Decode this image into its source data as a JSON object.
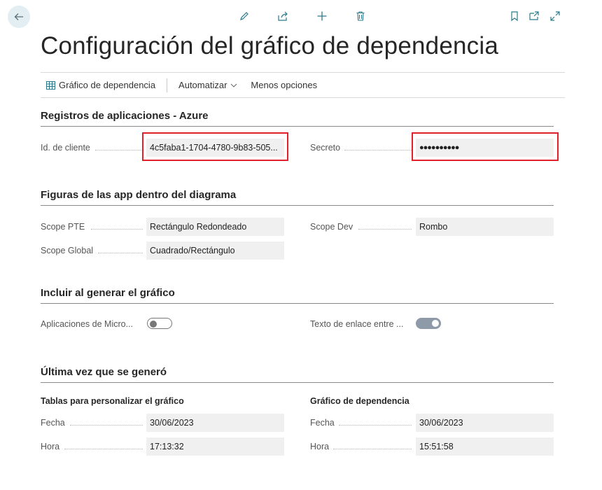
{
  "toolbar": {
    "icons": [
      "back-arrow-icon",
      "pencil-icon",
      "share-icon",
      "plus-icon",
      "trash-icon",
      "bookmark-icon",
      "popout-icon",
      "expand-icon"
    ]
  },
  "page": {
    "title": "Configuración del gráfico de dependencia"
  },
  "actions": {
    "chart": "Gráfico de dependencia",
    "automate": "Automatizar",
    "less_options": "Menos opciones"
  },
  "sections": {
    "azure": {
      "title": "Registros de aplicaciones - Azure",
      "client_id_label": "Id. de cliente",
      "client_id_value": "4c5faba1-1704-4780-9b83-505...",
      "secret_label": "Secreto",
      "secret_value": "●●●●●●●●●●"
    },
    "shapes": {
      "title": "Figuras de las app dentro del diagrama",
      "pte_label": "Scope PTE",
      "pte_value": "Rectángulo Redondeado",
      "dev_label": "Scope Dev",
      "dev_value": "Rombo",
      "global_label": "Scope Global",
      "global_value": "Cuadrado/Rectángulo"
    },
    "include": {
      "title": "Incluir al generar el gráfico",
      "ms_apps_label": "Aplicaciones de Micro...",
      "ms_apps_on": false,
      "link_text_label": "Texto de enlace entre ...",
      "link_text_on": true
    },
    "last": {
      "title": "Última vez que se generó",
      "left_subhead": "Tablas para personalizar el gráfico",
      "right_subhead": "Gráfico de dependencia",
      "date_label": "Fecha",
      "time_label": "Hora",
      "left_date": "30/06/2023",
      "left_time": "17:13:32",
      "right_date": "30/06/2023",
      "right_time": "15:51:58"
    }
  },
  "colors": {
    "highlight": "#e0202a",
    "toggle_on": "#8f9aa8",
    "field_bg": "#f0f0f0"
  }
}
